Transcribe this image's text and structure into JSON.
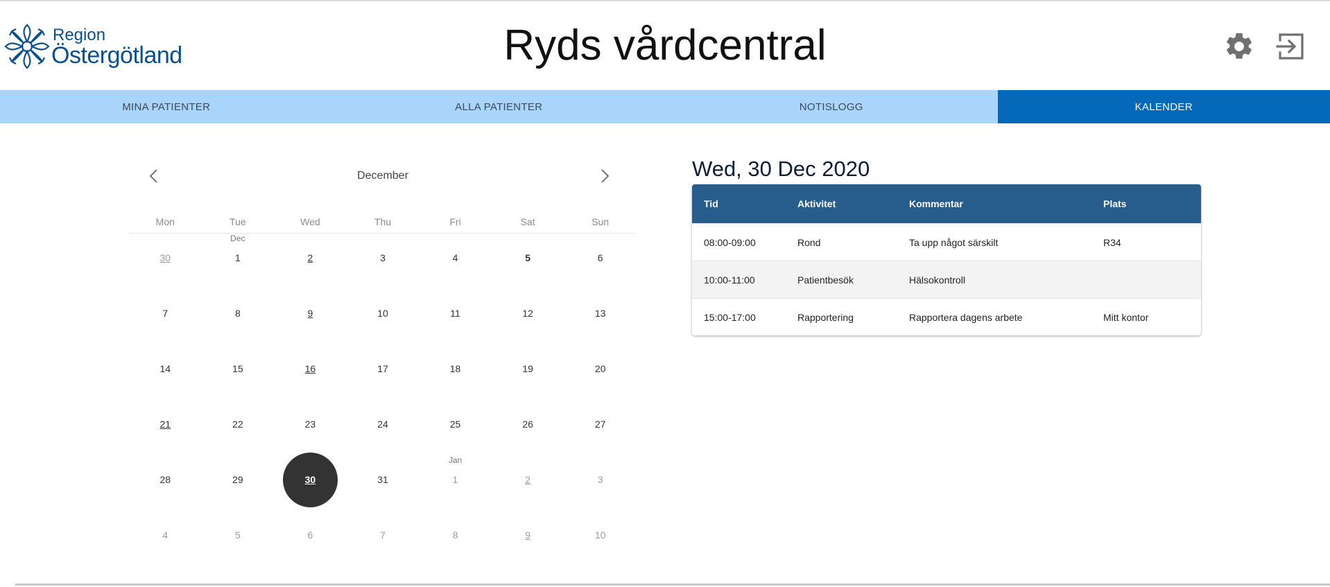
{
  "header": {
    "logo_line1": "Region",
    "logo_line2": "Östergötland",
    "title": "Ryds vårdcentral",
    "settings_icon": "gear-icon",
    "logout_icon": "logout-icon"
  },
  "nav": {
    "tabs": [
      {
        "label": "MINA PATIENTER",
        "active": false
      },
      {
        "label": "ALLA PATIENTER",
        "active": false
      },
      {
        "label": "NOTISLOGG",
        "active": false
      },
      {
        "label": "KALENDER",
        "active": true
      }
    ]
  },
  "calendar": {
    "month": "December",
    "prev_icon": "chevron-left-icon",
    "next_icon": "chevron-right-icon",
    "weekdays": [
      "Mon",
      "Tue",
      "Wed",
      "Thu",
      "Fri",
      "Sat",
      "Sun"
    ],
    "weeks": [
      [
        {
          "d": "30",
          "other": true,
          "u": true
        },
        {
          "d": "1",
          "m": "Dec"
        },
        {
          "d": "2",
          "u": true
        },
        {
          "d": "3"
        },
        {
          "d": "4"
        },
        {
          "d": "5",
          "b": true
        },
        {
          "d": "6"
        }
      ],
      [
        {
          "d": "7"
        },
        {
          "d": "8"
        },
        {
          "d": "9",
          "u": true
        },
        {
          "d": "10"
        },
        {
          "d": "11"
        },
        {
          "d": "12"
        },
        {
          "d": "13"
        }
      ],
      [
        {
          "d": "14"
        },
        {
          "d": "15"
        },
        {
          "d": "16",
          "u": true
        },
        {
          "d": "17"
        },
        {
          "d": "18"
        },
        {
          "d": "19"
        },
        {
          "d": "20"
        }
      ],
      [
        {
          "d": "21",
          "u": true
        },
        {
          "d": "22"
        },
        {
          "d": "23"
        },
        {
          "d": "24"
        },
        {
          "d": "25"
        },
        {
          "d": "26"
        },
        {
          "d": "27"
        }
      ],
      [
        {
          "d": "28"
        },
        {
          "d": "29"
        },
        {
          "d": "30",
          "u": true,
          "sel": true
        },
        {
          "d": "31"
        },
        {
          "d": "1",
          "other": true,
          "m": "Jan"
        },
        {
          "d": "2",
          "other": true,
          "u": true
        },
        {
          "d": "3",
          "other": true
        }
      ],
      [
        {
          "d": "4",
          "other": true
        },
        {
          "d": "5",
          "other": true
        },
        {
          "d": "6",
          "other": true
        },
        {
          "d": "7",
          "other": true
        },
        {
          "d": "8",
          "other": true
        },
        {
          "d": "9",
          "other": true,
          "u": true
        },
        {
          "d": "10",
          "other": true
        }
      ]
    ]
  },
  "schedule": {
    "date_title": "Wed, 30 Dec 2020",
    "columns": [
      "Tid",
      "Aktivitet",
      "Kommentar",
      "Plats"
    ],
    "rows": [
      [
        "08:00-09:00",
        "Rond",
        "Ta upp något särskilt",
        "R34"
      ],
      [
        "10:00-11:00",
        "Patientbesök",
        "Hälsokontroll",
        ""
      ],
      [
        "15:00-17:00",
        "Rapportering",
        "Rapportera dagens arbete",
        "Mitt kontor"
      ]
    ]
  },
  "colors": {
    "nav_bg": "#a9d5fc",
    "nav_active": "#0569b9",
    "table_header": "#275d8c",
    "brand": "#0a4f8f",
    "selected_day": "#333333"
  }
}
